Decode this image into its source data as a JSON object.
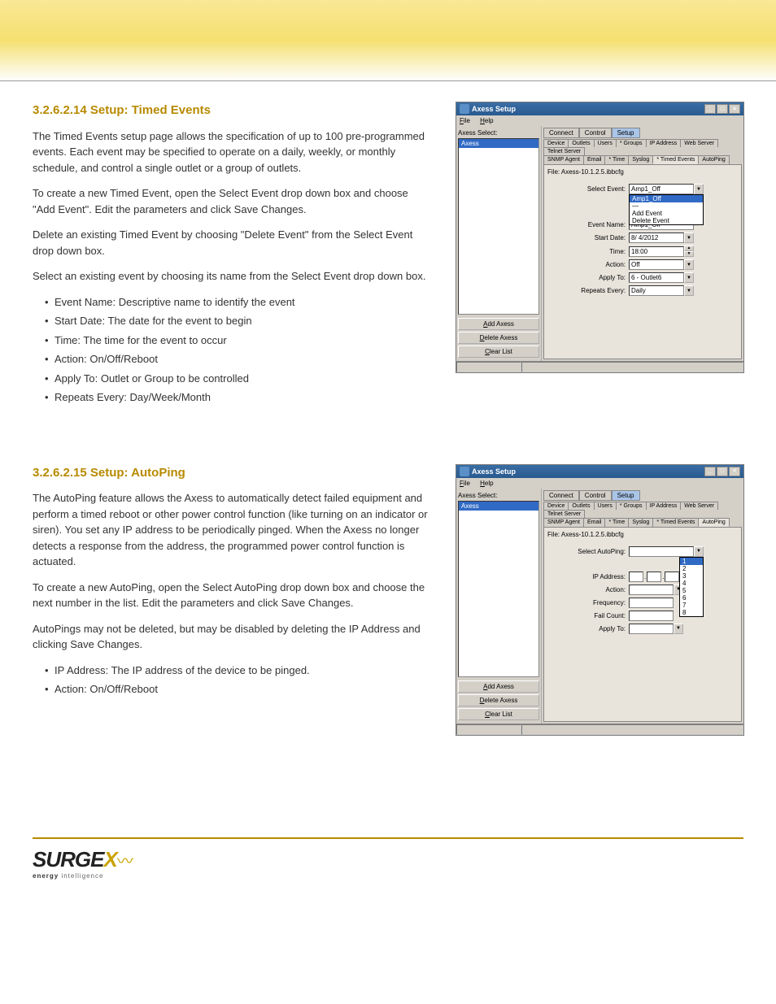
{
  "header_band": {},
  "sections": {
    "timed_events": {
      "title": "3.2.6.2.14 Setup: Timed Events",
      "paragraphs": [
        "The Timed Events setup page allows the specification of up to 100 pre-programmed events. Each event may be specified to operate on a daily, weekly, or monthly schedule, and control a single outlet or a group of outlets.",
        "To create a new Timed Event, open the Select Event drop down box and choose \"Add Event\". Edit the parameters and click Save Changes.",
        "Delete an existing Timed Event by choosing \"Delete Event\" from the Select Event drop down box.",
        "Select an existing event by choosing its name from the Select Event drop down box."
      ],
      "bullets": [
        "Event Name: Descriptive name to identify the event",
        "Start Date: The date for the event to begin",
        "Time: The time for the event to occur",
        "Action: On/Off/Reboot",
        "Apply To: Outlet or Group to be controlled",
        "Repeats Every: Day/Week/Month"
      ]
    },
    "autoping": {
      "title": "3.2.6.2.15 Setup: AutoPing",
      "paragraphs": [
        "The AutoPing feature allows the Axess to automatically detect failed equipment and perform a timed reboot or other power control function (like turning on an indicator or siren). You set any IP address to be periodically pinged. When the Axess no longer detects a response from the address, the programmed power control function is actuated.",
        "To create a new AutoPing, open the Select AutoPing drop down box and choose the next number in the list. Edit the parameters and click Save Changes.",
        "AutoPings may not be deleted, but may be disabled by deleting the IP Address and clicking Save Changes."
      ],
      "bullets": [
        "IP Address: The IP address of the device to be pinged.",
        "Action: On/Off/Reboot"
      ]
    }
  },
  "win": {
    "title": "Axess Setup",
    "menu": {
      "file": "File",
      "help": "Help"
    },
    "side_label": "Axess Select:",
    "side_item": "Axess",
    "side_btns": {
      "add": "Add Axess",
      "delete": "Delete Axess",
      "clear": "Clear List"
    },
    "mode_tabs": {
      "connect": "Connect",
      "control": "Control",
      "setup": "Setup"
    },
    "cfg_tabs_row1": [
      "Device",
      "Outlets",
      "Users",
      "* Groups",
      "IP Address",
      "Web Server",
      "Telnet Server"
    ],
    "cfg_tabs_row2": [
      "SNMP Agent",
      "Email",
      "* Time",
      "Syslog",
      "* Timed Events",
      "AutoPing"
    ],
    "file_label": "File: Axess-10.1.2.5.ibbcfg"
  },
  "timed_form": {
    "select_event_lbl": "Select Event:",
    "select_event_val": "Amp1_Off",
    "dropdown_items": {
      "sel": "Amp1_Off",
      "dash": "—",
      "add": "Add Event",
      "del": "Delete Event"
    },
    "event_name_lbl": "Event Name:",
    "event_name_val": "Amp1_Off",
    "start_date_lbl": "Start Date:",
    "start_date_val": "8/ 4/2012",
    "time_lbl": "Time:",
    "time_val": "18:00",
    "action_lbl": "Action:",
    "action_val": "Off",
    "applyto_lbl": "Apply To:",
    "applyto_val": "6 - Outlet6",
    "repeats_lbl": "Repeats Every:",
    "repeats_val": "Daily"
  },
  "autoping_form": {
    "select_lbl": "Select AutoPing:",
    "select_val": "",
    "dropdown_items": [
      "1",
      "2",
      "3",
      "4",
      "5",
      "6",
      "7",
      "8"
    ],
    "ip_lbl": "IP Address:",
    "action_lbl": "Action:",
    "action_val": "",
    "freq_lbl": "Frequency:",
    "freq_val": "",
    "fail_lbl": "Fail Count:",
    "fail_val": "",
    "applyto_lbl": "Apply To:",
    "applyto_val": ""
  },
  "footer": {
    "logo": "SURGE",
    "logo_x": "X",
    "tag_bold": "energy",
    "tag_rest": " intelligence"
  }
}
